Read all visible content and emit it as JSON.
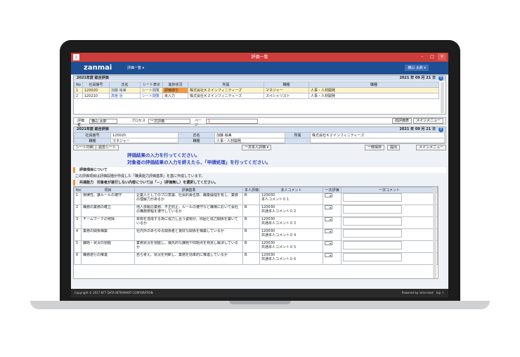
{
  "window": {
    "title": "評価一覧",
    "logo": "z"
  },
  "app": {
    "brand": "zanmai",
    "menu": "評価一覧 ▾",
    "user": "横山 太郎 ▾"
  },
  "top": {
    "section": "2021年度 総合評価",
    "date": "2021 年 09 月 21 日",
    "headers": [
      "No",
      "社員番号",
      "氏名",
      "シート表示",
      "進捗状況",
      "所属",
      "職種",
      "職種"
    ],
    "rows": [
      {
        "no": "1",
        "id": "120020",
        "name": "加藤 裕美",
        "sheet": "シート閲覧",
        "status": "評価待ち",
        "dept": "株式会社ＫＺインフィニティーズ",
        "role": "マネジャー",
        "job": "人事・人材開発"
      },
      {
        "no": "2",
        "id": "120210",
        "name": "高宮 治",
        "sheet": "シート閲覧",
        "status": "未入力",
        "dept": "株式会社ＫＺインフィニティーズ",
        "role": "スペシャリスト",
        "job": "人事・人材開発"
      }
    ]
  },
  "toolbar": {
    "rater_label": "評価者",
    "rater": "横山 太郎",
    "process_label": "プロセス",
    "process": "一次評価",
    "page_label": "ページ",
    "page": "1",
    "prev": "前評価表",
    "menu": "メインメニュー"
  },
  "info": {
    "title": "2021年度 総合評価",
    "date": "2021 年 09 月 21 日",
    "label_id": "社員番号",
    "id": "120020",
    "label_name": "氏名",
    "name": "加藤 裕美",
    "label_dept": "所属",
    "dept": "株式会社ＫＺインフィニティーズ",
    "label_role": "職種",
    "role": "マネジャー",
    "label_job": "職種",
    "job": "人事・人材開発"
  },
  "bar": {
    "print": "シート印刷",
    "next": "過去シート",
    "sheet": "一次本人評価 ▾",
    "b1": "一時保存",
    "b2": "提出",
    "b3": "メインメニュー"
  },
  "message": {
    "l1": "評価結果の入力を行ってください。",
    "l2": "対象者の評価結果の入力を終えたら、「申請処理」を行ってください。"
  },
  "sec1": {
    "title": "評価項目について",
    "note": "この評価項目は評価段階が作成した「職責能力評価基準」を基に作成しています。"
  },
  "sec2": {
    "title": "共通能力　対象者が遂行しない内容については「－」（評価無し）を選択してください。"
  },
  "grid": {
    "headers": [
      "No",
      "項目",
      "評価基準",
      "本人評価",
      "本人コメント",
      "一次評価",
      "一次コメント"
    ],
    "rows": [
      {
        "no": "1",
        "item": "規律性、誰ルールの遵守",
        "crit": "企業人としてのプロ意識、社会的責任感、職業倫理を有し、業務の理解力があるか",
        "self": "B",
        "comment": "120030\n本人コメント０１"
      },
      {
        "no": "2",
        "item": "職務の業務の確立",
        "crit": "他人依頼の業務、不正防止、ルールの遵守など職場において会社の職務規程を遵守しているか",
        "self": "B",
        "comment": "120030\n共通本人コメント０２"
      },
      {
        "no": "3",
        "item": "チームワークの発揮",
        "crit": "目標を達成する為に協力し合う姿勢が、周囲と協力関係を築いているか",
        "self": "B",
        "comment": "120030\n共通本人コメント０３"
      },
      {
        "no": "4",
        "item": "業務の関係構築",
        "crit": "社内外のあらゆる関係者と良好な関係を構築しているか",
        "self": "B",
        "comment": "120030\n共通本人コメント０４"
      },
      {
        "no": "5",
        "item": "課題・状況の把握",
        "crit": "業務状況を把握し、優先的な課題や問題点を発見し解決しているか",
        "self": "B",
        "comment": "120030\n共通本人コメント０５"
      },
      {
        "no": "6",
        "item": "職務遂行の推進",
        "crit": "自ら考え、状況を判断し、業務を効率的に推進しているか",
        "self": "B",
        "comment": "120030\n共通本人コメント０６"
      }
    ]
  },
  "footer": {
    "copy": "Copyright © 2017 NTT DATA INTRAMART CORPORATION",
    "right": "Powered by intra-mart　top ↑"
  }
}
